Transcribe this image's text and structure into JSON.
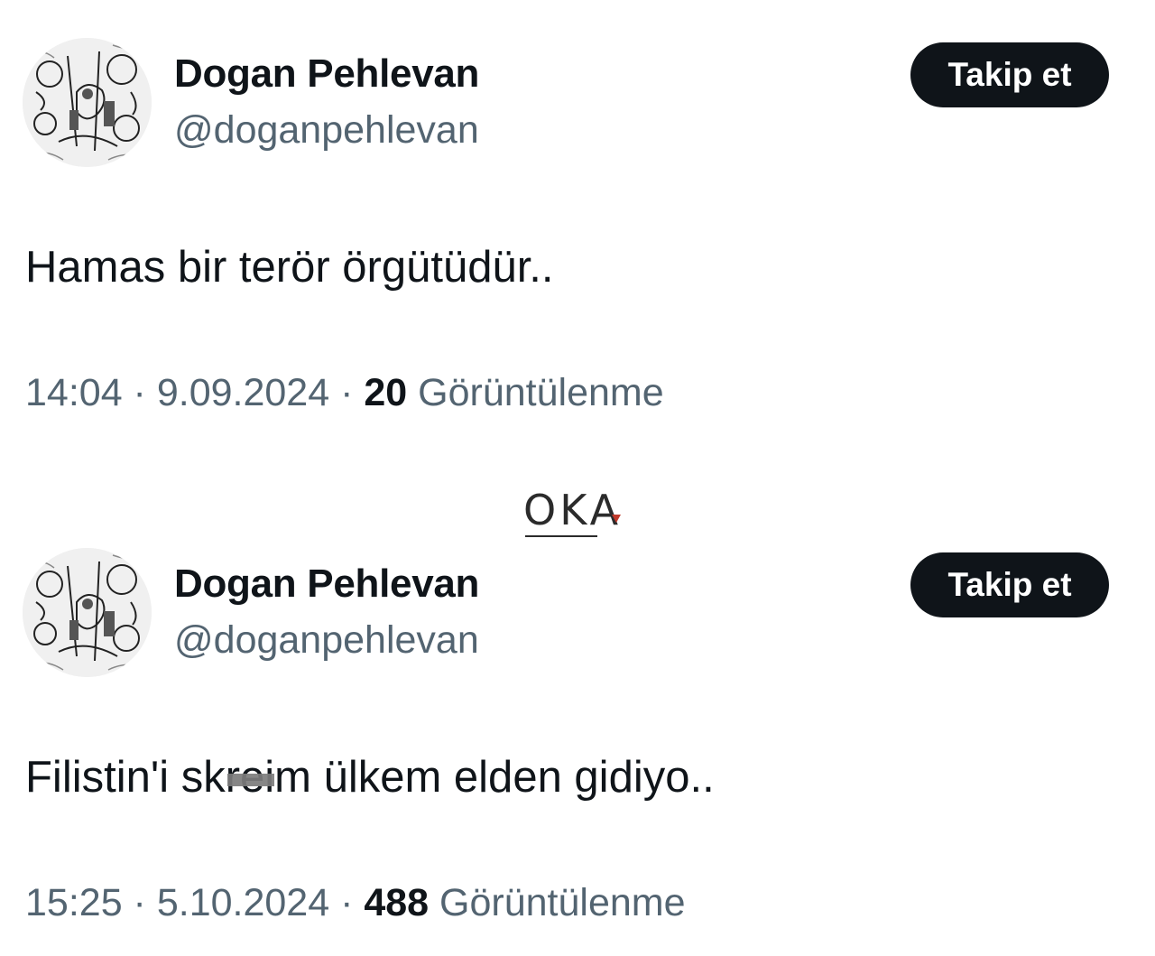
{
  "tweets": [
    {
      "display_name": "Dogan Pehlevan",
      "handle": "@doganpehlevan",
      "follow_label": "Takip et",
      "text_before": "Hamas bir terör örgütüdür..",
      "text_censored": "",
      "text_after": "",
      "time": "14:04",
      "date": "9.09.2024",
      "views_count": "20",
      "views_label": "Görüntülenme"
    },
    {
      "display_name": "Dogan Pehlevan",
      "handle": "@doganpehlevan",
      "follow_label": "Takip et",
      "text_before": "Filistin'i sk",
      "text_censored": "rei",
      "text_after": "m ülkem elden gidiyo..",
      "time": "15:25",
      "date": "5.10.2024",
      "views_count": "488",
      "views_label": "Görüntülenme"
    }
  ],
  "separator": " · ",
  "watermark": {
    "text": "OKA"
  },
  "colors": {
    "text_primary": "#0f1419",
    "text_secondary": "#536471",
    "button_bg": "#0f1419",
    "button_text": "#ffffff",
    "censor_bar": "#7c7c7c",
    "watermark_accent": "#c0392b"
  },
  "icons": {
    "avatar": "illustrated-avatar"
  }
}
